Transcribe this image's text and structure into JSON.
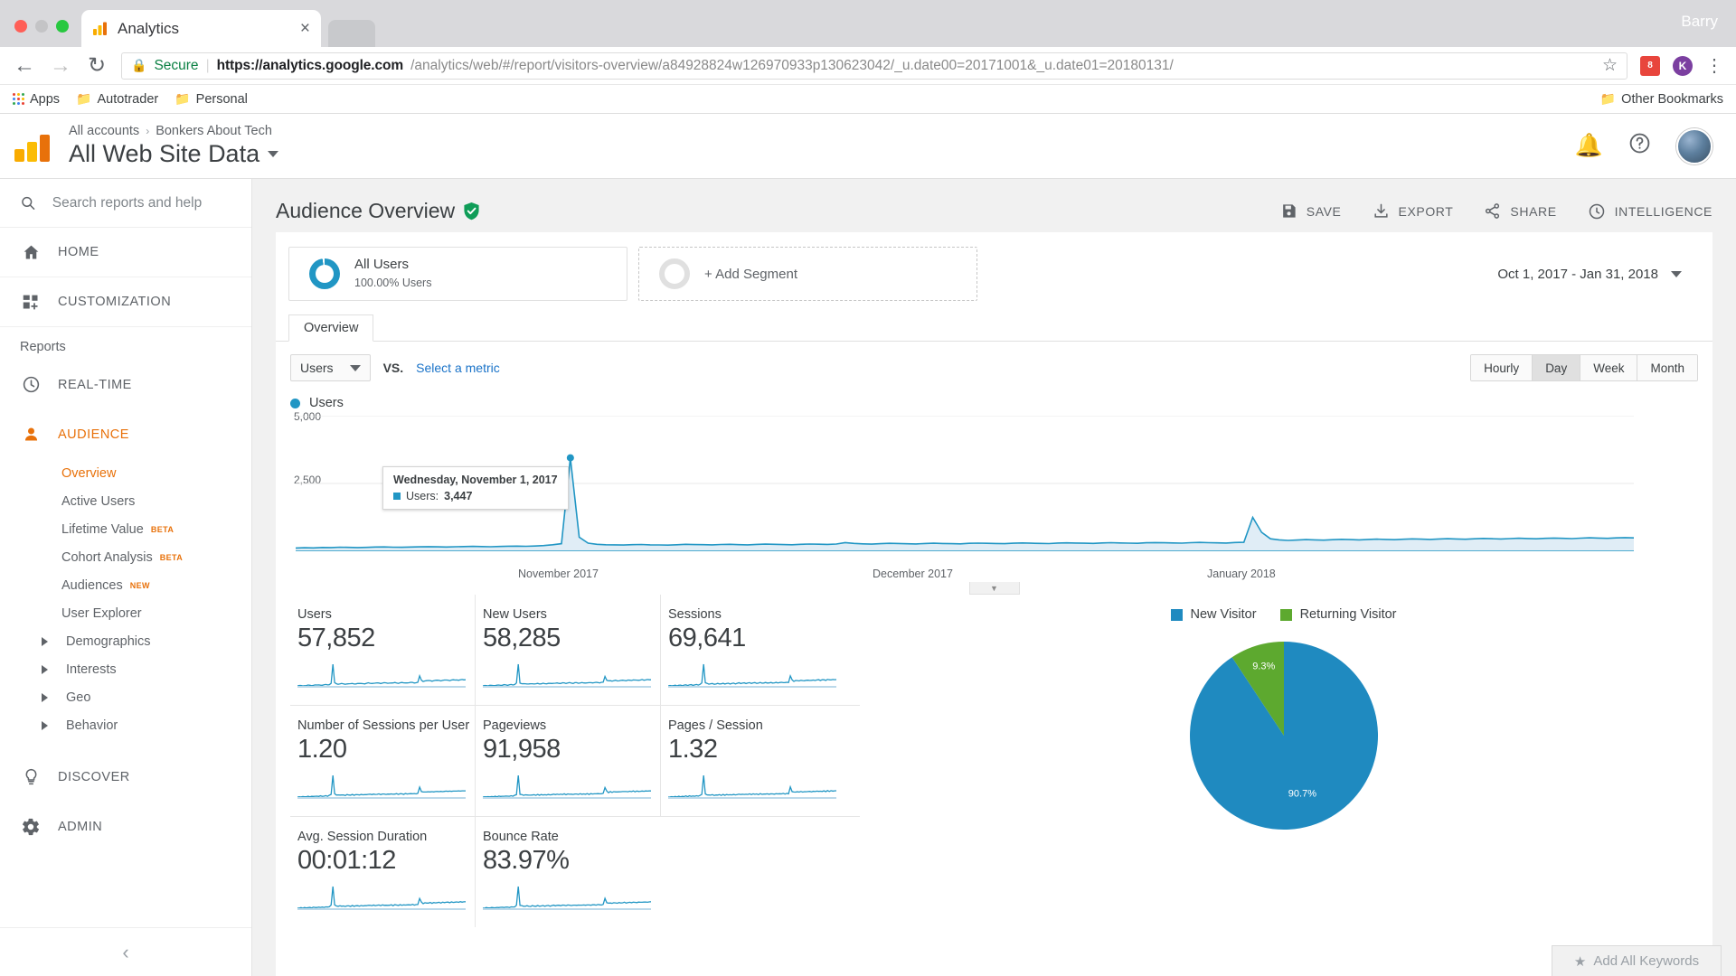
{
  "browser": {
    "tab_title": "Analytics",
    "tab_favicon_name": "analytics-favicon",
    "close_label": "×",
    "profile_name": "Barry",
    "secure_label": "Secure",
    "url_scheme": "https://",
    "url_host": "analytics.google.com",
    "url_path": "/analytics/web/#/report/visitors-overview/a84928824w126970933p130623042/_u.date00=20171001&_u.date01=20180131/",
    "back_glyph": "←",
    "forward_glyph": "→",
    "reload_glyph": "↻",
    "star_glyph": "☆",
    "kebab_glyph": "⋮",
    "ext_badge_text": "8",
    "ext_avatar_text": "K",
    "bookmarks": [
      {
        "label": "Apps",
        "icon": "apps-grid-icon"
      },
      {
        "label": "Autotrader",
        "icon": "folder-icon"
      },
      {
        "label": "Personal",
        "icon": "folder-icon"
      }
    ],
    "other_bookmarks": "Other Bookmarks"
  },
  "ga_header": {
    "logo_name": "google-analytics-logo",
    "breadcrumb": {
      "all_accounts": "All accounts",
      "separator": "›",
      "account": "Bonkers About Tech"
    },
    "property": "All Web Site Data",
    "notifications_icon": "bell-icon",
    "help_icon": "help-icon",
    "avatar_name": "user-avatar"
  },
  "sidebar": {
    "search_placeholder": "Search reports and help",
    "search_value": "",
    "nav": [
      {
        "label": "HOME",
        "icon": "home-icon",
        "name": "sidebar-item-home"
      },
      {
        "label": "CUSTOMIZATION",
        "icon": "customization-icon",
        "name": "sidebar-item-customization"
      }
    ],
    "reports_label": "Reports",
    "reports": [
      {
        "label": "REAL-TIME",
        "icon": "clock-icon",
        "name": "sidebar-item-real-time",
        "active": false
      },
      {
        "label": "AUDIENCE",
        "icon": "person-icon",
        "name": "sidebar-item-audience",
        "active": true
      }
    ],
    "audience_sub": [
      {
        "label": "Overview",
        "selected": true,
        "expandable": false,
        "tag": ""
      },
      {
        "label": "Active Users",
        "selected": false,
        "expandable": false,
        "tag": ""
      },
      {
        "label": "Lifetime Value",
        "selected": false,
        "expandable": false,
        "tag": "BETA"
      },
      {
        "label": "Cohort Analysis",
        "selected": false,
        "expandable": false,
        "tag": "BETA"
      },
      {
        "label": "Audiences",
        "selected": false,
        "expandable": false,
        "tag": "NEW"
      },
      {
        "label": "User Explorer",
        "selected": false,
        "expandable": false,
        "tag": ""
      },
      {
        "label": "Demographics",
        "selected": false,
        "expandable": true,
        "tag": ""
      },
      {
        "label": "Interests",
        "selected": false,
        "expandable": true,
        "tag": ""
      },
      {
        "label": "Geo",
        "selected": false,
        "expandable": true,
        "tag": ""
      },
      {
        "label": "Behavior",
        "selected": false,
        "expandable": true,
        "tag": ""
      }
    ],
    "footer_nav": [
      {
        "label": "DISCOVER",
        "icon": "lightbulb-icon",
        "name": "sidebar-item-discover"
      },
      {
        "label": "ADMIN",
        "icon": "gear-icon",
        "name": "sidebar-item-admin"
      }
    ],
    "collapse_glyph": "‹"
  },
  "main": {
    "page_title": "Audience Overview",
    "verified_badge": "verified-shield-icon",
    "actions": [
      {
        "label": "SAVE",
        "icon": "save-icon"
      },
      {
        "label": "EXPORT",
        "icon": "export-icon"
      },
      {
        "label": "SHARE",
        "icon": "share-icon"
      },
      {
        "label": "INTELLIGENCE",
        "icon": "intelligence-icon"
      }
    ],
    "segment": {
      "name": "All Users",
      "sub": "100.00% Users",
      "add_label": "+ Add Segment"
    },
    "date_range": "Oct 1, 2017 - Jan 31, 2018",
    "tab_overview": "Overview",
    "metric_select": "Users",
    "vs_label": "VS.",
    "select_metric": "Select a metric",
    "granularity": [
      {
        "label": "Hourly",
        "active": false
      },
      {
        "label": "Day",
        "active": true
      },
      {
        "label": "Week",
        "active": false
      },
      {
        "label": "Month",
        "active": false
      }
    ],
    "chart_legend": "Users",
    "tooltip": {
      "title": "Wednesday, November 1, 2017",
      "series": "Users:",
      "value": "3,447"
    },
    "add_keywords": "Add All Keywords",
    "star_glyph": "★"
  },
  "chart_data": {
    "type": "line",
    "title": "Users",
    "ylabel": "Users",
    "xlabel": "",
    "ylim": [
      0,
      5000
    ],
    "yticks": [
      2500,
      5000
    ],
    "ytick_labels": [
      "2,500",
      "5,000"
    ],
    "grid": true,
    "legend_position": "top-left",
    "x_tick_labels": [
      "November 2017",
      "December 2017",
      "January 2018"
    ],
    "annotation": {
      "x": "Wednesday, November 1, 2017",
      "y": 3447,
      "label": "Users: 3,447"
    },
    "series": [
      {
        "name": "Users",
        "color": "#2196c4",
        "values": [
          120,
          130,
          125,
          140,
          135,
          150,
          145,
          138,
          142,
          155,
          160,
          150,
          148,
          158,
          165,
          170,
          162,
          158,
          168,
          175,
          180,
          172,
          168,
          178,
          185,
          190,
          182,
          195,
          210,
          240,
          280,
          3447,
          520,
          300,
          255,
          240,
          235,
          230,
          245,
          250,
          238,
          232,
          228,
          240,
          255,
          248,
          242,
          236,
          250,
          258,
          245,
          238,
          252,
          262,
          255,
          248,
          240,
          258,
          268,
          260,
          252,
          268,
          320,
          290,
          272,
          265,
          280,
          292,
          285,
          276,
          270,
          288,
          296,
          288,
          280,
          274,
          292,
          300,
          294,
          286,
          280,
          298,
          306,
          298,
          290,
          284,
          302,
          310,
          304,
          296,
          290,
          308,
          316,
          308,
          300,
          294,
          312,
          320,
          314,
          306,
          300,
          318,
          326,
          318,
          310,
          304,
          322,
          330,
          1250,
          700,
          460,
          420,
          400,
          415,
          430,
          420,
          410,
          428,
          440,
          430,
          420,
          436,
          448,
          438,
          428,
          444,
          456,
          446,
          436,
          452,
          464,
          454,
          444,
          460,
          472,
          462,
          452,
          468,
          480,
          470,
          460,
          476,
          488,
          478,
          468,
          484,
          496,
          486,
          476,
          492,
          504,
          494
        ]
      }
    ]
  },
  "metric_cards": [
    {
      "label": "Users",
      "value": "57,852"
    },
    {
      "label": "New Users",
      "value": "58,285"
    },
    {
      "label": "Sessions",
      "value": "69,641"
    },
    {
      "label": "Number of Sessions per User",
      "value": "1.20"
    },
    {
      "label": "Pageviews",
      "value": "91,958"
    },
    {
      "label": "Pages / Session",
      "value": "1.32"
    },
    {
      "label": "Avg. Session Duration",
      "value": "00:01:12"
    },
    {
      "label": "Bounce Rate",
      "value": "83.97%"
    }
  ],
  "pie_chart": {
    "type": "pie",
    "title": "",
    "legend_position": "top",
    "slices": [
      {
        "label": "New Visitor",
        "value": 90.7,
        "display": "90.7%",
        "color": "#1f8ac0"
      },
      {
        "label": "Returning Visitor",
        "value": 9.3,
        "display": "9.3%",
        "color": "#5da92f"
      }
    ]
  },
  "colors": {
    "accent_orange": "#e8710a",
    "chart_blue": "#2196c4",
    "link_blue": "#1a73c8",
    "green": "#5da92f"
  }
}
